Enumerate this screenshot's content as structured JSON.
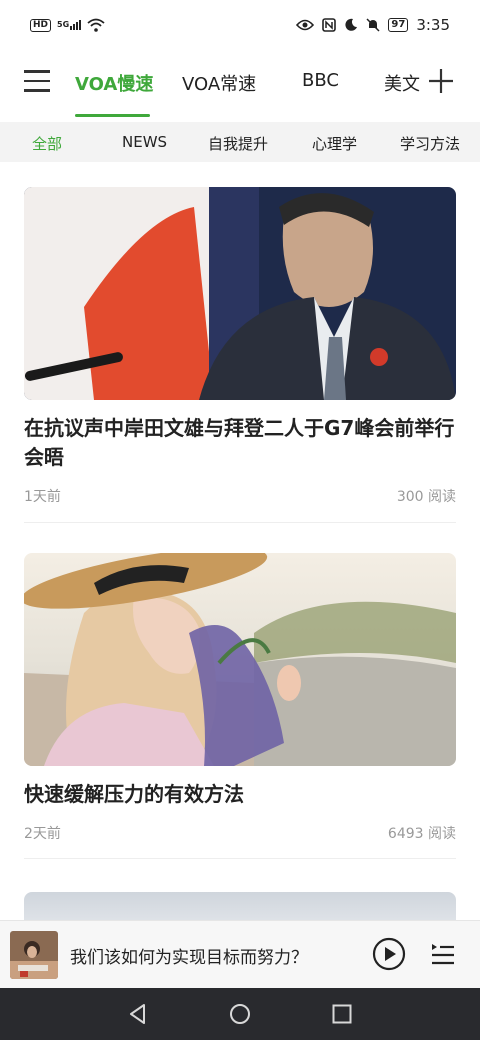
{
  "status_bar": {
    "hd_label": "HD",
    "signal_label": "5G",
    "battery": "97",
    "time": "3:35",
    "icons": [
      "hd-icon",
      "signal-icon",
      "wifi-icon",
      "eye-icon",
      "nfc-icon",
      "moon-icon",
      "mute-icon",
      "battery-icon"
    ]
  },
  "top_tabs": [
    {
      "label": "VOA慢速",
      "active": true
    },
    {
      "label": "VOA常速",
      "active": false
    },
    {
      "label": "BBC",
      "active": false
    },
    {
      "label": "美文",
      "active": false
    }
  ],
  "categories": [
    {
      "label": "全部",
      "active": true
    },
    {
      "label": "NEWS",
      "active": false
    },
    {
      "label": "自我提升",
      "active": false
    },
    {
      "label": "心理学",
      "active": false
    },
    {
      "label": "学习方法",
      "active": false
    }
  ],
  "articles": [
    {
      "title": "在抗议声中岸田文雄与拜登二人于G7峰会前举行会晤",
      "time": "1天前",
      "reads": "300 阅读"
    },
    {
      "title": "快速缓解压力的有效方法",
      "time": "2天前",
      "reads": "6493 阅读"
    }
  ],
  "player": {
    "title": "我们该如何为实现目标而努力？"
  },
  "colors": {
    "accent": "#3fa83b",
    "text": "#222222",
    "meta": "#999999",
    "category_bg": "#f3f3f3",
    "navbar": "#292a2e"
  }
}
